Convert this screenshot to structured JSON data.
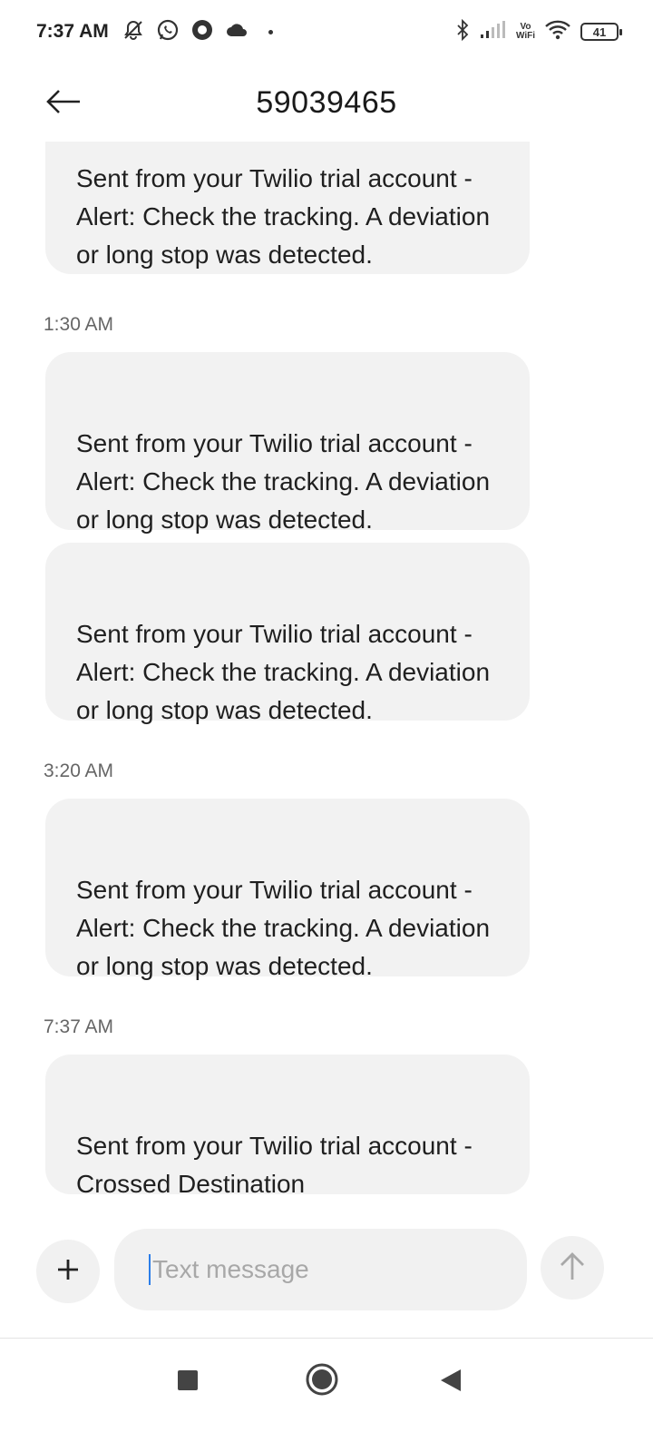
{
  "status_bar": {
    "time": "7:37 AM",
    "left_icons": [
      "muted-alarm-icon",
      "whatsapp-icon",
      "circle-app-icon",
      "cloud-icon",
      "dot-icon"
    ],
    "right_icons": [
      "bluetooth-icon",
      "signal-icon",
      "vowifi-icon",
      "wifi-icon",
      "battery-icon"
    ],
    "vowifi_top": "Vo",
    "vowifi_bottom": "WiFi",
    "battery": "41"
  },
  "header": {
    "title": "59039465",
    "back_icon": "arrow-left-icon"
  },
  "thread": {
    "messages": [
      {
        "text": "Sent from your Twilio trial account -\nAlert: Check the tracking. A deviation\nor long stop was detected."
      },
      {
        "timestamp": "1:30 AM",
        "text": "Sent from your Twilio trial account -\nAlert: Check the tracking. A deviation\nor long stop was detected."
      },
      {
        "text": "Sent from your Twilio trial account -\nAlert: Check the tracking. A deviation\nor long stop was detected."
      },
      {
        "timestamp": "3:20 AM",
        "text": "Sent from your Twilio trial account -\nAlert: Check the tracking. A deviation\nor long stop was detected."
      },
      {
        "timestamp": "7:37 AM",
        "text": "Sent from your Twilio trial account -\nCrossed Destination"
      }
    ]
  },
  "composer": {
    "add_icon": "plus-icon",
    "placeholder": "Text message",
    "value": "",
    "send_icon": "arrow-up-icon"
  },
  "nav_bar": {
    "icons": [
      "square-recents-icon",
      "circle-home-icon",
      "triangle-back-icon"
    ]
  },
  "colors": {
    "bubble": "#f2f2f2",
    "caret": "#2b7de9",
    "placeholder": "#a8a8a8"
  }
}
